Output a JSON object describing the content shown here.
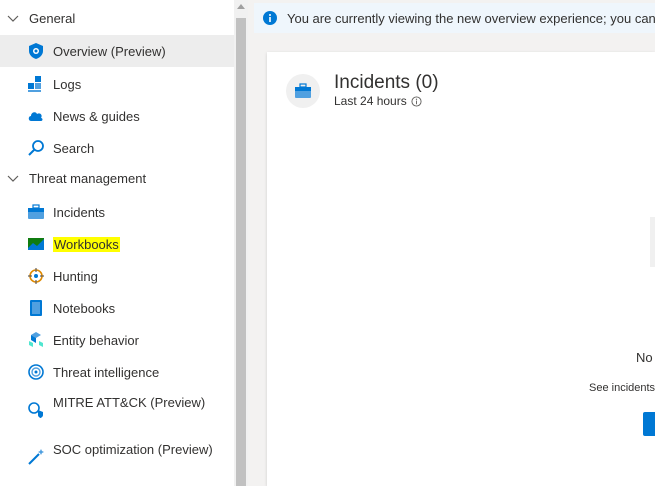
{
  "sidebar": {
    "groups": [
      {
        "label": "General"
      },
      {
        "label": "Threat management"
      }
    ],
    "items": [
      {
        "label": "Overview (Preview)"
      },
      {
        "label": "Logs"
      },
      {
        "label": "News & guides"
      },
      {
        "label": "Search"
      },
      {
        "label": "Incidents"
      },
      {
        "label": "Workbooks"
      },
      {
        "label": "Hunting"
      },
      {
        "label": "Notebooks"
      },
      {
        "label": "Entity behavior"
      },
      {
        "label": "Threat intelligence"
      },
      {
        "label": "MITRE ATT&CK (Preview)"
      },
      {
        "label": "SOC optimization (Preview)"
      }
    ]
  },
  "banner": {
    "text": "You are currently viewing the new overview experience; you can alway"
  },
  "incidents_card": {
    "title": "Incidents (0)",
    "subtitle": "Last 24 hours",
    "empty_text": "No",
    "see_text": "See incidents"
  },
  "colors": {
    "accent": "#0078d4",
    "highlight": "#ffff00",
    "selected_bg": "#ededed"
  }
}
